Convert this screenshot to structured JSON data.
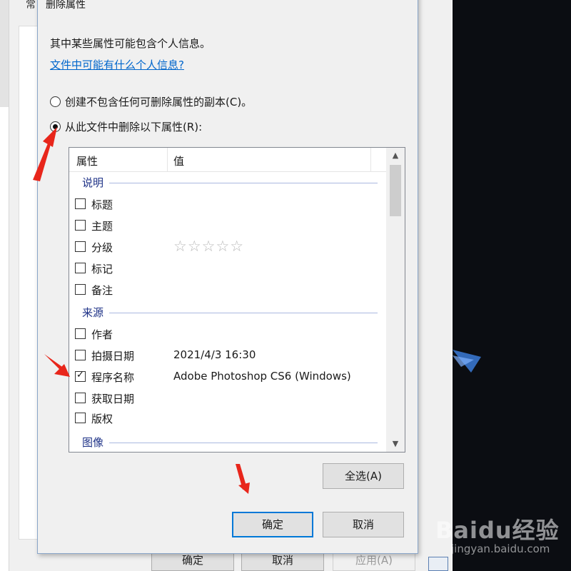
{
  "parent_window": {
    "tab_char": "常",
    "ok_label": "确定",
    "cancel_label": "取消",
    "apply_label": "应用(A)"
  },
  "dialog": {
    "title": "删除属性",
    "intro": "其中某些属性可能包含个人信息。",
    "info_link": "文件中可能有什么个人信息?",
    "option_copy": "创建不包含任何可删除属性的副本(C)。",
    "option_remove": "从此文件中删除以下属性(R):",
    "selected_option": "option_remove"
  },
  "listview": {
    "columns": [
      "属性",
      "值"
    ],
    "groups": [
      {
        "label": "说明",
        "rows": [
          {
            "name": "标题",
            "value": "",
            "checked": false
          },
          {
            "name": "主题",
            "value": "",
            "checked": false
          },
          {
            "name": "分级",
            "value": "☆☆☆☆☆",
            "checked": false
          },
          {
            "name": "标记",
            "value": "",
            "checked": false
          },
          {
            "name": "备注",
            "value": "",
            "checked": false
          }
        ]
      },
      {
        "label": "来源",
        "rows": [
          {
            "name": "作者",
            "value": "",
            "checked": false
          },
          {
            "name": "拍摄日期",
            "value": "2021/4/3 16:30",
            "checked": false
          },
          {
            "name": "程序名称",
            "value": "Adobe Photoshop CS6 (Windows)",
            "checked": true
          },
          {
            "name": "获取日期",
            "value": "",
            "checked": false
          },
          {
            "name": "版权",
            "value": "",
            "checked": false
          }
        ]
      },
      {
        "label": "图像",
        "rows": []
      }
    ]
  },
  "buttons": {
    "select_all": "全选(A)",
    "ok": "确定",
    "cancel": "取消"
  },
  "watermark": {
    "logo": "Baidu经验",
    "url": "jingyan.baidu.com"
  },
  "colors": {
    "link": "#0066cc",
    "group_label": "#1e3287",
    "annotation_arrow": "#e8261b",
    "default_button_border": "#0078d7"
  }
}
